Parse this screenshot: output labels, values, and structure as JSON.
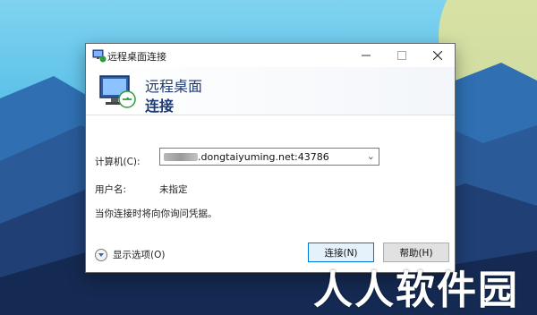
{
  "window": {
    "title": "远程桌面连接",
    "header_line1": "远程桌面",
    "header_line2": "连接"
  },
  "form": {
    "computer_label": "计算机(C):",
    "computer_value": ".dongtaiyuming.net:43786",
    "user_label": "用户名:",
    "user_value": "未指定",
    "hint": "当你连接时将向你询问凭据。"
  },
  "footer": {
    "options_label": "显示选项(O)",
    "connect_label": "连接(N)",
    "help_label": "帮助(H)"
  },
  "watermark": "人人软件园",
  "colors": {
    "accent": "#0078d7",
    "title_text": "#1e3a73"
  },
  "icons": {
    "title_bar": "remote-desktop-icon",
    "header": "remote-desktop-monitor-icon",
    "dropdown": "chevron-down-icon",
    "expand": "expand-options-icon"
  }
}
